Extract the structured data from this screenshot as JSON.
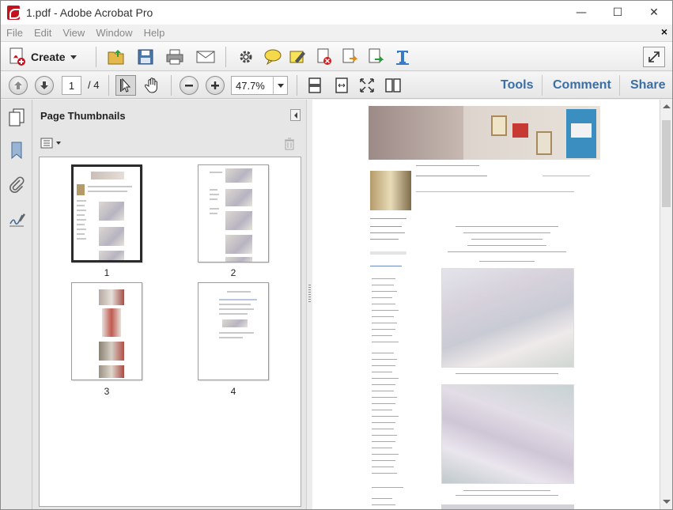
{
  "window": {
    "title": "1.pdf - Adobe Acrobat Pro",
    "minimize": "—",
    "maximize": "☐",
    "close": "✕"
  },
  "menu": {
    "items": [
      "File",
      "Edit",
      "View",
      "Window",
      "Help"
    ],
    "close_doc": "×"
  },
  "toolbar": {
    "create_label": "Create"
  },
  "navigation": {
    "current_page": "1",
    "page_total": "/ 4",
    "zoom": "47.7%"
  },
  "right_links": {
    "tools": "Tools",
    "comment": "Comment",
    "share": "Share"
  },
  "thumbnails_panel": {
    "title": "Page Thumbnails",
    "pages": [
      "1",
      "2",
      "3",
      "4"
    ],
    "selected_page": "1"
  },
  "colors": {
    "accent_link": "#3b6ea5",
    "acrobat_red": "#c4121e"
  }
}
